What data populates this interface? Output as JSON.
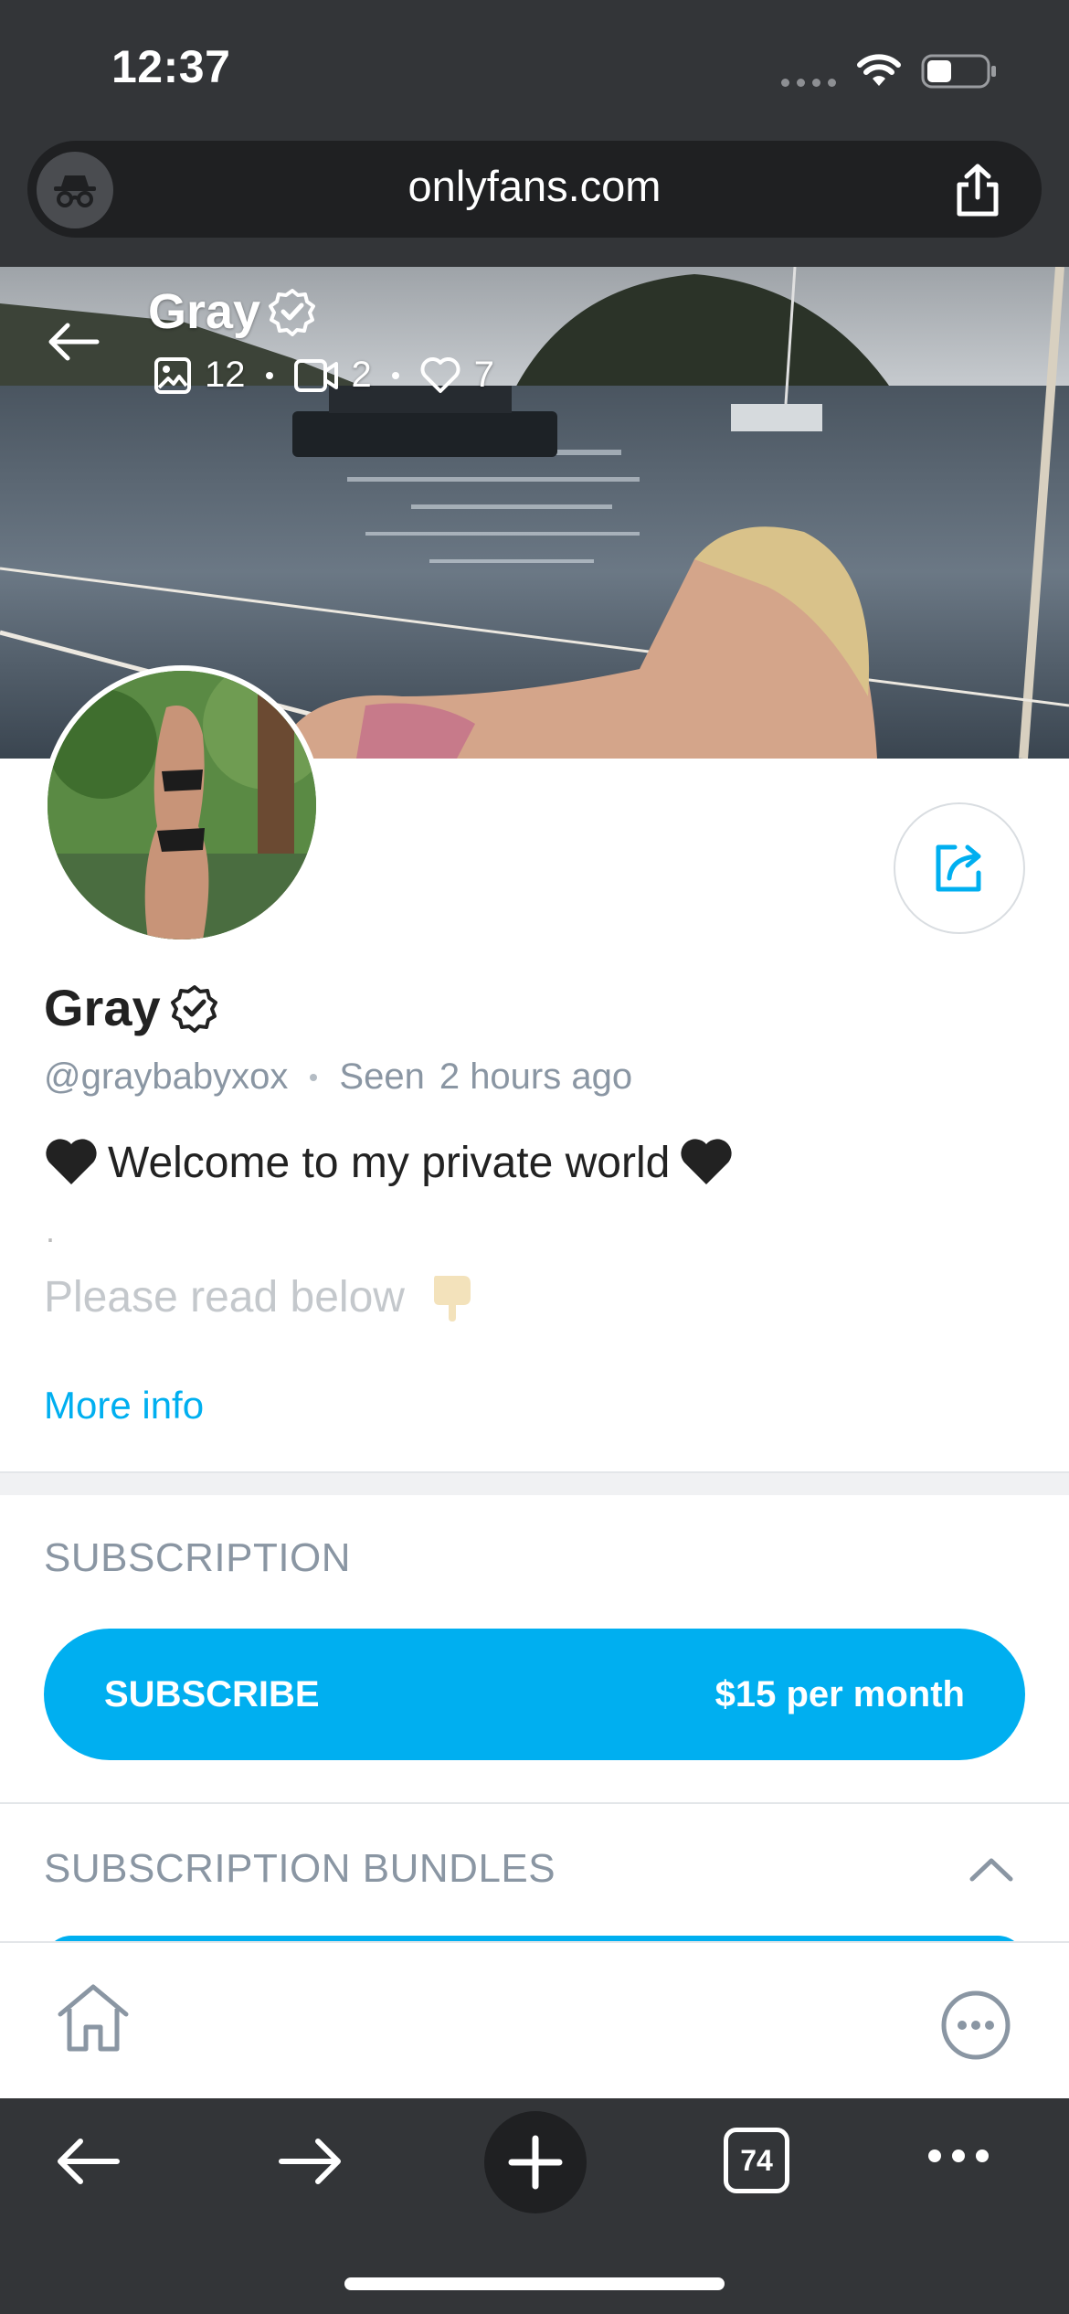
{
  "status_bar": {
    "time": "12:37"
  },
  "browser": {
    "url": "onlyfans.com",
    "tab_count": "74"
  },
  "profile": {
    "name": "Gray",
    "cover_name": "Gray",
    "stats": {
      "photos": "12",
      "videos": "2",
      "likes": "7"
    },
    "handle": "@graybabyxox",
    "seen_label": "Seen",
    "seen_time": "2 hours ago",
    "bio_line1": "Welcome to my private world",
    "bio_line2": ".",
    "bio_line3": "Please read below",
    "more_info": "More info"
  },
  "subscription": {
    "section_title": "SUBSCRIPTION",
    "button_label": "SUBSCRIBE",
    "price": "$15 per month",
    "bundles_title": "SUBSCRIPTION BUNDLES"
  },
  "colors": {
    "accent": "#00aff0",
    "muted": "#8a96a3",
    "chrome": "#333538"
  },
  "icons": [
    "incognito-icon",
    "share-icon",
    "back-arrow-icon",
    "verified-icon",
    "image-icon",
    "video-icon",
    "heart-icon",
    "share-profile-icon",
    "black-heart-icon",
    "pointing-down-icon",
    "chevron-up-icon",
    "home-icon",
    "more-icon",
    "forward-arrow-icon",
    "plus-icon",
    "tabs-icon"
  ]
}
